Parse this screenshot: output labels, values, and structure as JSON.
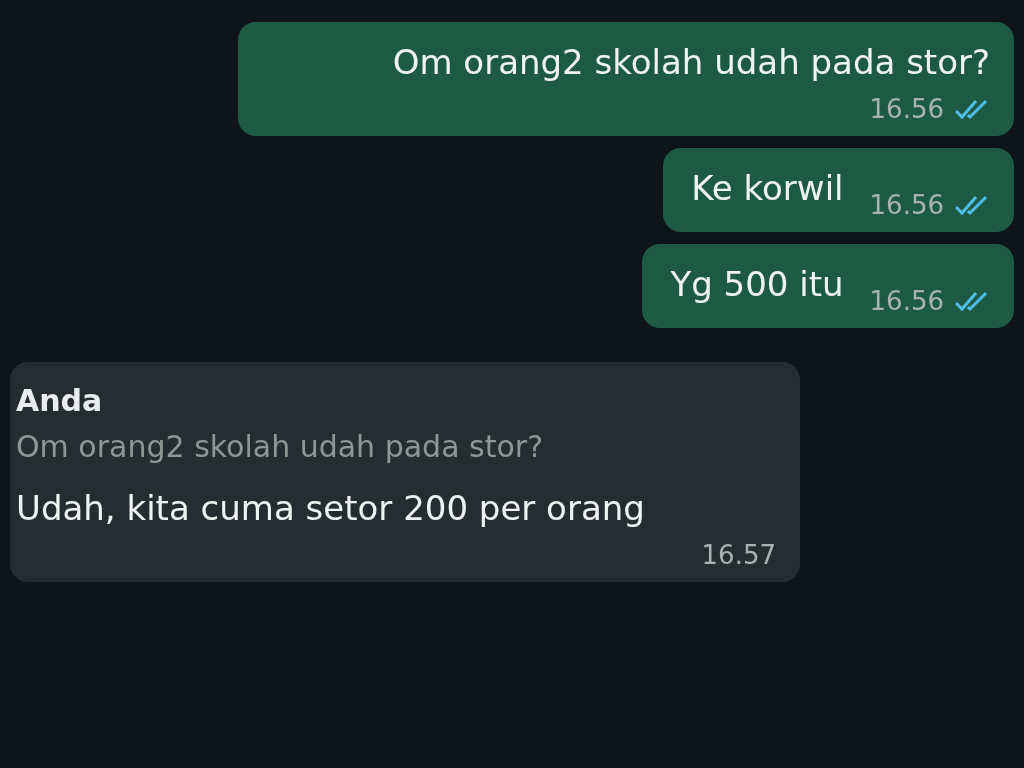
{
  "messages": [
    {
      "kind": "outgoing",
      "text": "Om orang2 skolah udah pada stor?",
      "time": "16.56",
      "read": true
    },
    {
      "kind": "outgoing",
      "text": "Ke korwil",
      "time": "16.56",
      "read": true
    },
    {
      "kind": "outgoing",
      "text": "Yg 500 itu",
      "time": "16.56",
      "read": true
    },
    {
      "kind": "incoming",
      "quote": {
        "author": "Anda",
        "text": "Om orang2 skolah udah pada stor?"
      },
      "text": "Udah, kita cuma setor 200 per orang",
      "time": "16.57"
    }
  ]
}
